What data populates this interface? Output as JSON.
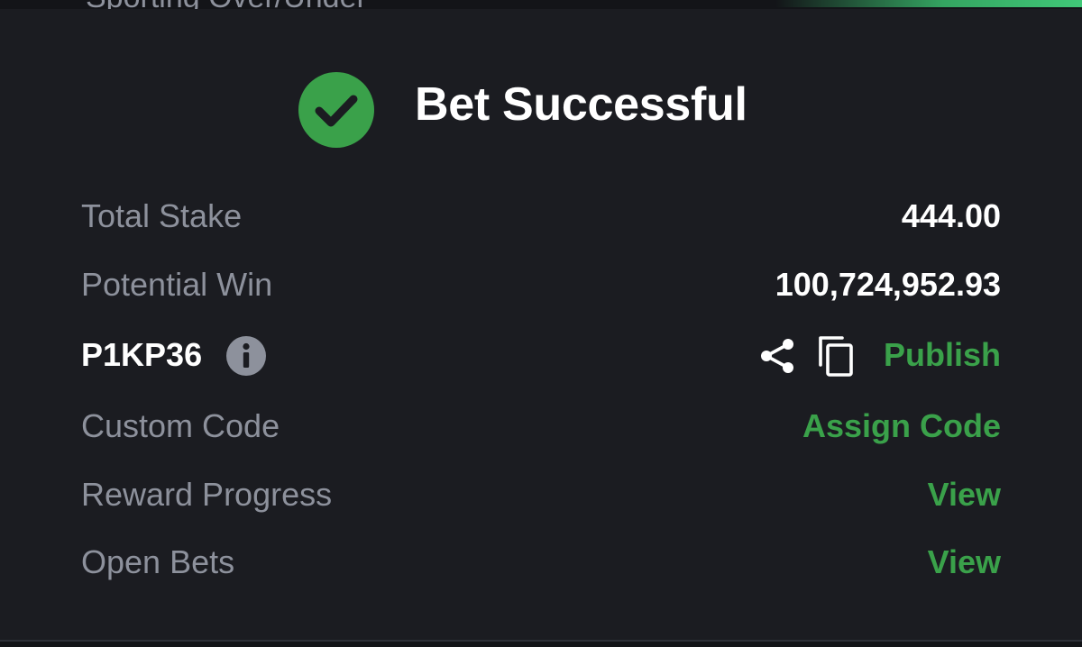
{
  "background_header": {
    "peek_text": "Sporting Over/Under"
  },
  "status": {
    "title": "Bet Successful",
    "icon": "check-circle-icon",
    "color": "#3aa14a"
  },
  "summary": {
    "total_stake_label": "Total Stake",
    "total_stake_value": "444.00",
    "potential_win_label": "Potential Win",
    "potential_win_value": "100,724,952.93"
  },
  "booking": {
    "code": "P1KP36",
    "info_icon": "info-icon",
    "share_icon": "share-icon",
    "copy_icon": "copy-icon",
    "publish_label": "Publish"
  },
  "links": {
    "custom_code_label": "Custom Code",
    "custom_code_action": "Assign Code",
    "reward_progress_label": "Reward Progress",
    "reward_progress_action": "View",
    "open_bets_label": "Open Bets",
    "open_bets_action": "View"
  },
  "colors": {
    "background": "#1b1c21",
    "accent_green": "#3aa14a",
    "label_gray": "#8d919c",
    "text_white": "#ffffff"
  }
}
